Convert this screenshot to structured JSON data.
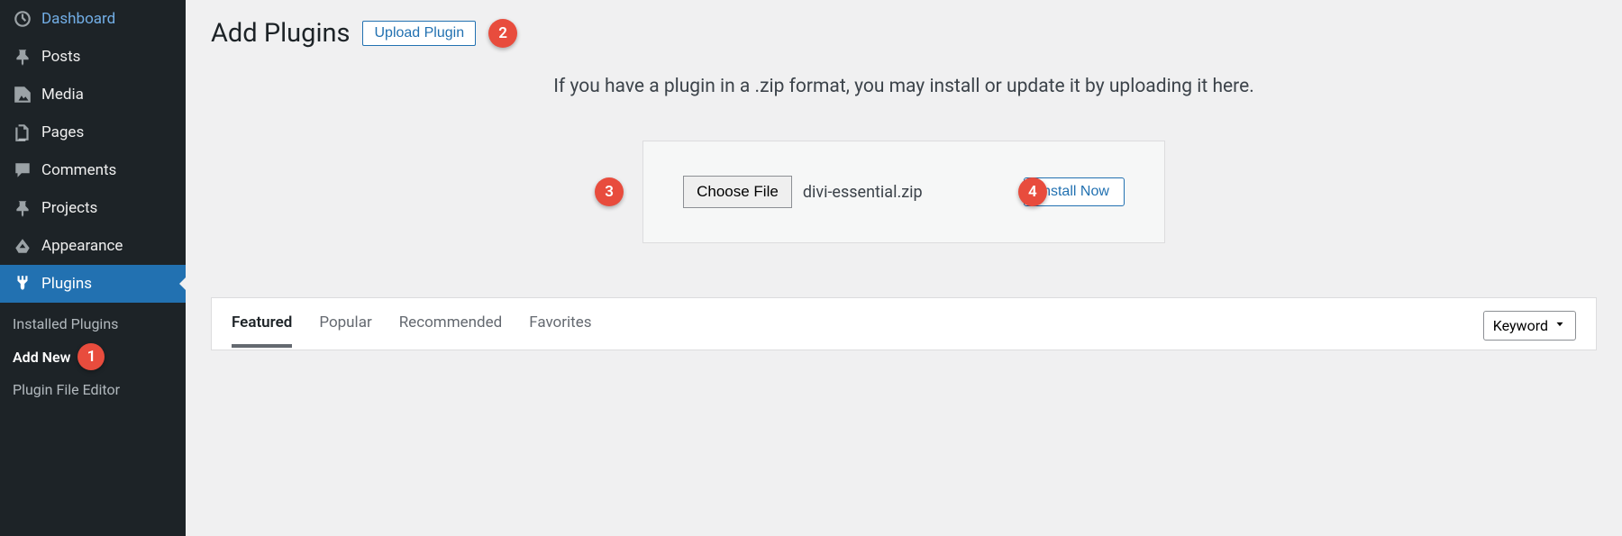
{
  "sidebar": {
    "items": [
      {
        "label": "Dashboard"
      },
      {
        "label": "Posts"
      },
      {
        "label": "Media"
      },
      {
        "label": "Pages"
      },
      {
        "label": "Comments"
      },
      {
        "label": "Projects"
      },
      {
        "label": "Appearance"
      },
      {
        "label": "Plugins"
      }
    ],
    "submenu": [
      {
        "label": "Installed Plugins"
      },
      {
        "label": "Add New"
      },
      {
        "label": "Plugin File Editor"
      }
    ]
  },
  "header": {
    "title": "Add Plugins",
    "upload_btn": "Upload Plugin"
  },
  "upload": {
    "instruction": "If you have a plugin in a .zip format, you may install or update it by uploading it here.",
    "choose_file": "Choose File",
    "file_name": "divi-essential.zip",
    "install_btn": "Install Now"
  },
  "badges": {
    "b1": "1",
    "b2": "2",
    "b3": "3",
    "b4": "4"
  },
  "filter": {
    "tabs": [
      "Featured",
      "Popular",
      "Recommended",
      "Favorites"
    ],
    "select_label": "Keyword"
  }
}
